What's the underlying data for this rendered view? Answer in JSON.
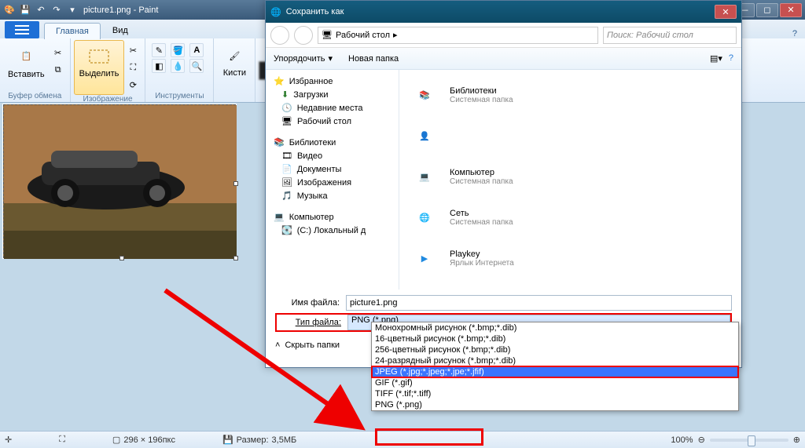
{
  "window": {
    "title": "picture1.png - Paint"
  },
  "tabs": {
    "main": "Главная",
    "view": "Вид"
  },
  "ribbon": {
    "paste": "Вставить",
    "select": "Выделить",
    "brushes": "Кисти",
    "group_clipboard": "Буфер обмена",
    "group_image": "Изображение",
    "group_tools": "Инструменты"
  },
  "status": {
    "dims": "296 × 196пкс",
    "size_label": "Размер:",
    "size_val": "3,5МБ",
    "zoom": "100%"
  },
  "dialog": {
    "title": "Сохранить как",
    "breadcrumb": "Рабочий стол",
    "search_ph": "Поиск: Рабочий стол",
    "organize": "Упорядочить",
    "newfolder": "Новая папка",
    "sidebar": {
      "fav": "Избранное",
      "dl": "Загрузки",
      "recent": "Недавние места",
      "desk": "Рабочий стол",
      "lib": "Библиотеки",
      "vid": "Видео",
      "doc": "Документы",
      "img": "Изображения",
      "mus": "Музыка",
      "comp": "Компьютер",
      "cdrive": "(C:) Локальный д"
    },
    "main": {
      "libs": {
        "t": "Библиотеки",
        "s": "Системная папка"
      },
      "comp": {
        "t": "Компьютер",
        "s": "Системная папка"
      },
      "net": {
        "t": "Сеть",
        "s": "Системная папка"
      },
      "pk": {
        "t": "Playkey",
        "s": "Ярлык Интернета"
      }
    },
    "fname_label": "Имя файла:",
    "fname": "picture1.png",
    "ftype_label": "Тип файла:",
    "ftype": "PNG (*.png)",
    "hide": "Скрыть папки"
  },
  "dropdown": [
    "Монохромный рисунок (*.bmp;*.dib)",
    "16-цветный рисунок (*.bmp;*.dib)",
    "256-цветный рисунок (*.bmp;*.dib)",
    "24-разрядный рисунок (*.bmp;*.dib)",
    "JPEG (*.jpg;*.jpeg;*.jpe;*.jfif)",
    "GIF (*.gif)",
    "TIFF (*.tif;*.tiff)",
    "PNG (*.png)"
  ]
}
